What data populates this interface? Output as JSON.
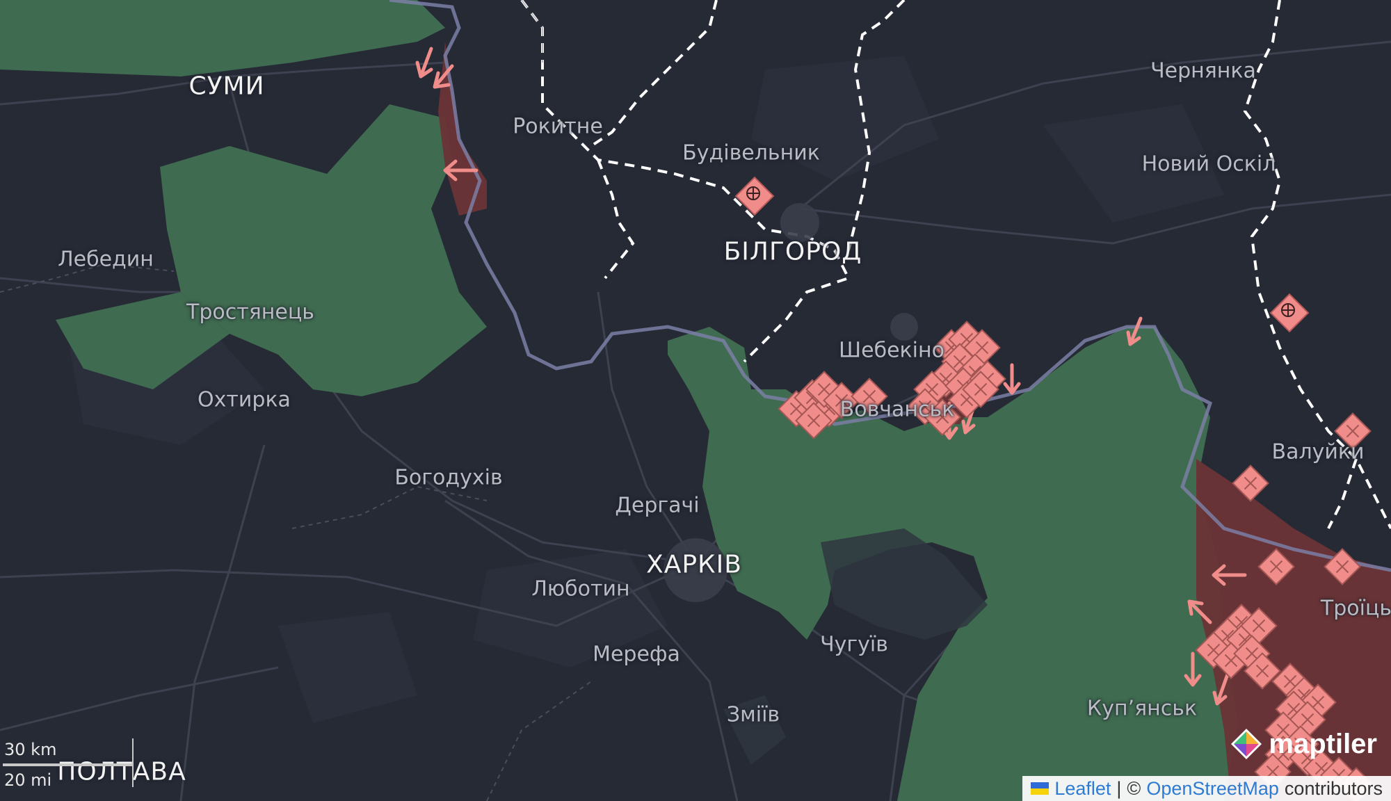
{
  "map": {
    "cities_major": [
      "СУМИ",
      "БІЛГОРОД",
      "ХАРКІВ",
      "ПОЛТАВА"
    ],
    "towns": [
      "Рокитне",
      "Будівельник",
      "Чернянка",
      "Новий Оскіл",
      "Лебедин",
      "Тростянець",
      "Охтирка",
      "Шебекіно",
      "Вовчанськ",
      "Валуйки",
      "Богодухів",
      "Дергачі",
      "Люботин",
      "Мерефа",
      "Чугуїв",
      "Змiїв",
      "Куп’янськ",
      "Троїць"
    ],
    "colors": {
      "background": "#262a35",
      "ukraine_control": "#3f6b50",
      "russia_advance": "#6b3437",
      "border": "#7b7fa6",
      "attack_marker": "#f08c89",
      "railway": "#ffffff"
    },
    "icons": [
      "attack-direction-arrow-icon",
      "assault-diamond-icon",
      "air-base-icon"
    ]
  },
  "scale": {
    "km": "30 km",
    "mi": "20 mi"
  },
  "attribution": {
    "leaflet": "Leaflet",
    "separator": "|",
    "copyright": "©",
    "osm": "OpenStreetMap",
    "contributors": "contributors"
  },
  "logo": {
    "text": "maptiler"
  }
}
